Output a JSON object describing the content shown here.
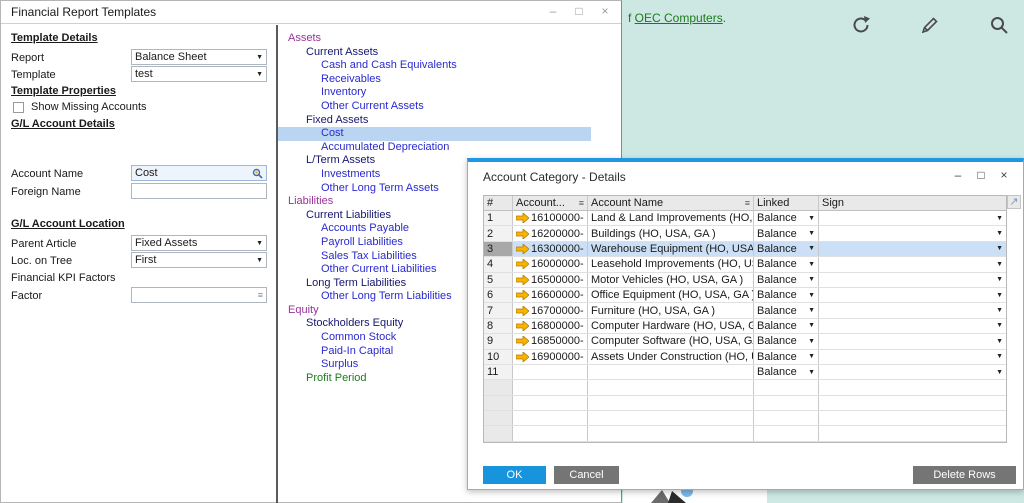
{
  "colors": {
    "teal_bg": "#cde8e2",
    "selection_blue": "#b9d5f1",
    "dialog_top_border": "#1f97e5",
    "ok_button": "#1794dc",
    "gray_button": "#757575",
    "link_green": "#1c7a1c",
    "arrow_orange": "#f7b500",
    "tree": {
      "purple": "#993399",
      "navy": "#16166e",
      "blue": "#2a2ace",
      "green": "#1e7a1e"
    }
  },
  "window": {
    "title": "Financial Report Templates",
    "controls": {
      "minimize": "–",
      "maximize": "□",
      "close": "×"
    }
  },
  "form": {
    "template_details_heading": "Template Details",
    "report_label": "Report",
    "report_value": "Balance Sheet",
    "template_label": "Template",
    "template_value": "test",
    "template_properties_heading": "Template Properties",
    "show_missing_accounts_label": "Show Missing Accounts",
    "show_missing_accounts_checked": false,
    "gl_account_details_heading": "G/L Account Details",
    "account_name_label": "Account Name",
    "account_name_value": "Cost",
    "foreign_name_label": "Foreign Name",
    "foreign_name_value": "",
    "gl_account_location_heading": "G/L Account Location",
    "parent_article_label": "Parent Article",
    "parent_article_value": "Fixed Assets",
    "loc_on_tree_label": "Loc. on Tree",
    "loc_on_tree_value": "First",
    "financial_kpi_heading": "Financial KPI Factors",
    "factor_label": "Factor",
    "factor_value": ""
  },
  "tree": {
    "items": [
      {
        "label": "Assets",
        "level": 1,
        "color": "purple",
        "selected": false
      },
      {
        "label": "Current Assets",
        "level": 2,
        "color": "navy",
        "selected": false
      },
      {
        "label": "Cash and Cash Equivalents",
        "level": 3,
        "color": "blue",
        "selected": false
      },
      {
        "label": "Receivables",
        "level": 3,
        "color": "blue",
        "selected": false
      },
      {
        "label": "Inventory",
        "level": 3,
        "color": "blue",
        "selected": false
      },
      {
        "label": "Other Current Assets",
        "level": 3,
        "color": "blue",
        "selected": false
      },
      {
        "label": "Fixed Assets",
        "level": 2,
        "color": "navy",
        "selected": false
      },
      {
        "label": "Cost",
        "level": 3,
        "color": "blue",
        "selected": true
      },
      {
        "label": "Accumulated Depreciation",
        "level": 3,
        "color": "blue",
        "selected": false
      },
      {
        "label": "L/Term Assets",
        "level": 2,
        "color": "navy",
        "selected": false
      },
      {
        "label": "Investments",
        "level": 3,
        "color": "blue",
        "selected": false
      },
      {
        "label": "Other Long Term Assets",
        "level": 3,
        "color": "blue",
        "selected": false
      },
      {
        "label": "Liabilities",
        "level": 1,
        "color": "purple",
        "selected": false
      },
      {
        "label": "Current Liabilities",
        "level": 2,
        "color": "navy",
        "selected": false
      },
      {
        "label": "Accounts Payable",
        "level": 3,
        "color": "blue",
        "selected": false
      },
      {
        "label": "Payroll Liabilities",
        "level": 3,
        "color": "blue",
        "selected": false
      },
      {
        "label": "Sales Tax Liabilities",
        "level": 3,
        "color": "blue",
        "selected": false
      },
      {
        "label": "Other Current Liabilities",
        "level": 3,
        "color": "blue",
        "selected": false
      },
      {
        "label": "Long Term Liabilities",
        "level": 2,
        "color": "navy",
        "selected": false
      },
      {
        "label": "Other Long Term Liabilities",
        "level": 3,
        "color": "blue",
        "selected": false
      },
      {
        "label": "Equity",
        "level": 1,
        "color": "purple",
        "selected": false
      },
      {
        "label": "Stockholders Equity",
        "level": 2,
        "color": "navy",
        "selected": false
      },
      {
        "label": "Common Stock",
        "level": 3,
        "color": "blue",
        "selected": false
      },
      {
        "label": "Paid-In Capital",
        "level": 3,
        "color": "blue",
        "selected": false
      },
      {
        "label": "Surplus",
        "level": 3,
        "color": "blue",
        "selected": false
      },
      {
        "label": "Profit Period",
        "level": 2,
        "color": "green",
        "selected": false
      }
    ]
  },
  "background": {
    "sentence_prefix": "f ",
    "company_link": "OEC Computers",
    "sentence_suffix": "."
  },
  "dialog": {
    "title": "Account Category - Details",
    "controls": {
      "minimize": "–",
      "maximize": "□",
      "close": "×"
    },
    "expand_icon": "↗",
    "table": {
      "columns": [
        {
          "label": "#",
          "has_filter_icon": false
        },
        {
          "label": "Account...",
          "has_filter_icon": true
        },
        {
          "label": "Account Name",
          "has_filter_icon": true
        },
        {
          "label": "Linked",
          "has_filter_icon": false
        },
        {
          "label": "Sign",
          "has_filter_icon": false
        }
      ],
      "rows": [
        {
          "num": "1",
          "account": "16100000-",
          "name": "Land & Land Improvements (HO, USA, GA )",
          "linked": "Balance",
          "sign": ""
        },
        {
          "num": "2",
          "account": "16200000-",
          "name": "Buildings (HO, USA, GA )",
          "linked": "Balance",
          "sign": ""
        },
        {
          "num": "3",
          "account": "16300000-",
          "name": "Warehouse Equipment (HO, USA, GA )",
          "linked": "Balance",
          "sign": ""
        },
        {
          "num": "4",
          "account": "16000000-",
          "name": "Leasehold Improvements (HO, USA, GA )",
          "linked": "Balance",
          "sign": ""
        },
        {
          "num": "5",
          "account": "16500000-",
          "name": "Motor Vehicles (HO, USA, GA )",
          "linked": "Balance",
          "sign": ""
        },
        {
          "num": "6",
          "account": "16600000-",
          "name": "Office Equipment (HO, USA, GA )",
          "linked": "Balance",
          "sign": ""
        },
        {
          "num": "7",
          "account": "16700000-",
          "name": "Furniture (HO, USA, GA )",
          "linked": "Balance",
          "sign": ""
        },
        {
          "num": "8",
          "account": "16800000-",
          "name": "Computer Hardware (HO, USA, GA )",
          "linked": "Balance",
          "sign": ""
        },
        {
          "num": "9",
          "account": "16850000-",
          "name": "Computer Software (HO, USA, GA )",
          "linked": "Balance",
          "sign": ""
        },
        {
          "num": "10",
          "account": "16900000-",
          "name": "Assets Under Construction (HO, USA, GA )",
          "linked": "Balance",
          "sign": ""
        },
        {
          "num": "11",
          "account": "",
          "name": "",
          "linked": "Balance",
          "sign": ""
        }
      ],
      "selected_row_num": "3",
      "empty_row_count": 4
    },
    "buttons": {
      "ok": "OK",
      "cancel": "Cancel",
      "delete_rows": "Delete Rows"
    }
  }
}
